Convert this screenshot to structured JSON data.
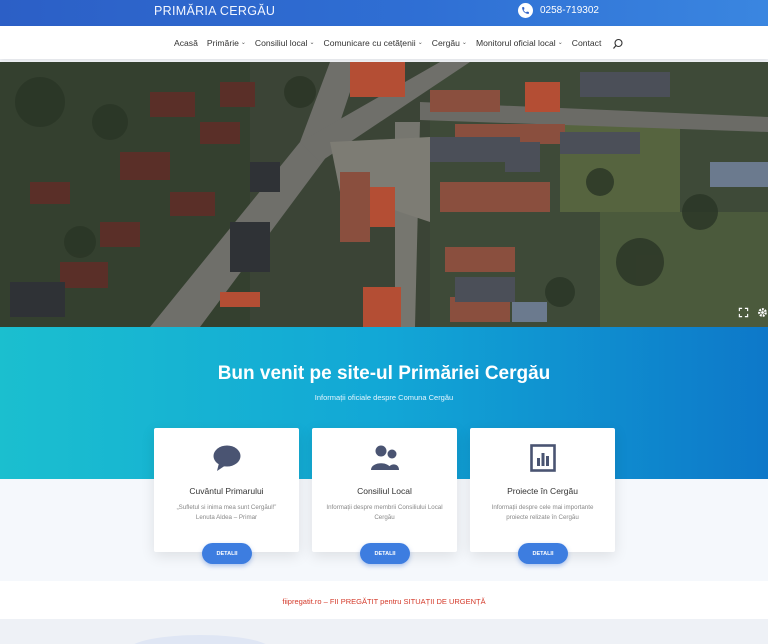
{
  "header": {
    "site_title": "PRIMĂRIA CERGĂU",
    "phone": "0258-719302",
    "phone_icon": "phone-icon"
  },
  "nav": {
    "items": [
      {
        "label": "Acasă",
        "dropdown": false
      },
      {
        "label": "Primărie",
        "dropdown": true
      },
      {
        "label": "Consiliul local",
        "dropdown": true
      },
      {
        "label": "Comunicare cu cetățenii",
        "dropdown": true
      },
      {
        "label": "Cergău",
        "dropdown": true
      },
      {
        "label": "Monitorul oficial local",
        "dropdown": true
      },
      {
        "label": "Contact",
        "dropdown": false
      }
    ],
    "search_icon": "search-icon"
  },
  "hero": {
    "image": "aerial-village-photo",
    "controls": [
      "fullscreen-icon",
      "gear-icon"
    ]
  },
  "welcome": {
    "title": "Bun venit pe site-ul Primăriei Cergău",
    "subtitle": "Informații oficiale despre Comuna Cergău"
  },
  "cards": [
    {
      "icon": "speech-bubble-icon",
      "title": "Cuvântul Primarului",
      "text": "„Sufletul si inima mea sunt Cergăul!”",
      "text2": "Lenuta Aldea – Primar",
      "button": "DETALII"
    },
    {
      "icon": "users-icon",
      "title": "Consiliul Local",
      "text": "Informații despre membrii Consiliului Local Cergău",
      "text2": "",
      "button": "DETALII"
    },
    {
      "icon": "bar-chart-icon",
      "title": "Proiecte în Cergău",
      "text": "Informații despre cele mai importante proiecte relizate în Cergău",
      "text2": "",
      "button": "DETALII"
    }
  ],
  "notice": {
    "text": "fiipregatit.ro – FII PREGĂTIT pentru SITUAȚII DE URGENȚĂ"
  },
  "colors": {
    "topbar": "#2c5fc6",
    "accent": "#3d7de0",
    "welcome_start": "#1bbfcf",
    "welcome_end": "#0d78c9",
    "notice": "#d43a2a"
  }
}
